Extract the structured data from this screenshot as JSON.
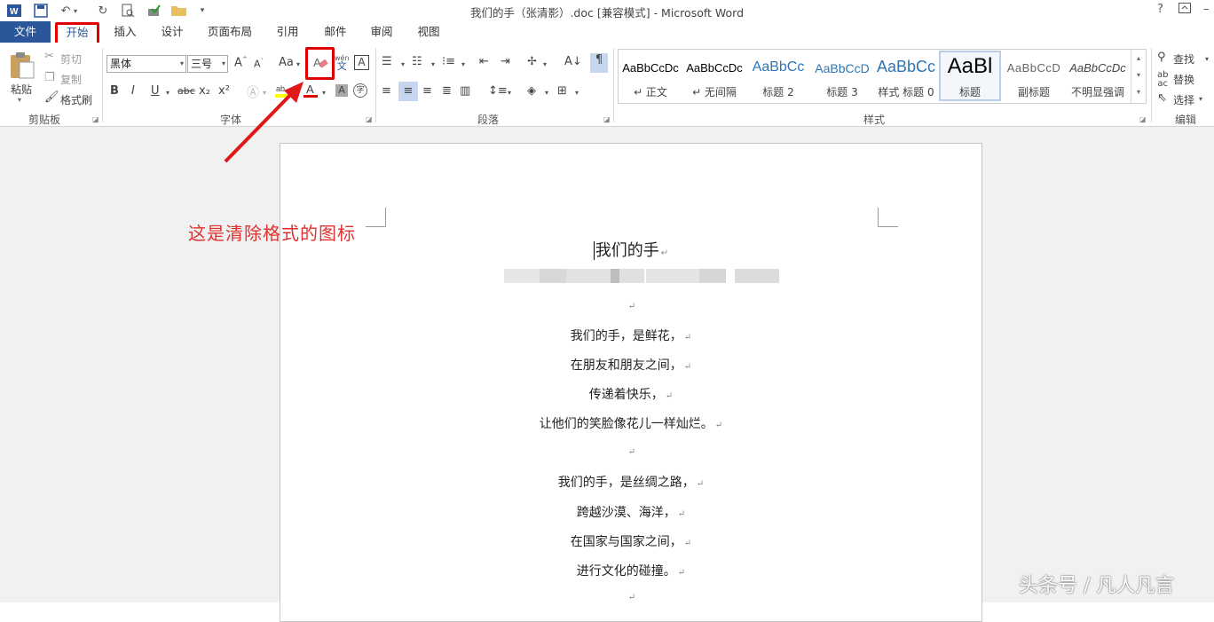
{
  "window": {
    "title": "我们的手（张清影）.doc [兼容模式] - Microsoft Word",
    "help": "?",
    "restore_icon": "ribbon-display-icon",
    "min": "–"
  },
  "tabs": [
    "文件",
    "开始",
    "插入",
    "设计",
    "页面布局",
    "引用",
    "邮件",
    "审阅",
    "视图"
  ],
  "clipboard": {
    "paste": "粘贴",
    "cut": "剪切",
    "copy": "复制",
    "format_painter": "格式刷",
    "group": "剪贴板"
  },
  "font": {
    "name": "黑体",
    "size": "三号",
    "group": "字体",
    "change_case": "Aa",
    "bold": "B",
    "italic": "I",
    "underline": "U",
    "strike": "abc",
    "sub": "x₂",
    "sup": "x²",
    "phonetic_top": "wén",
    "phonetic_bottom": "文",
    "charborder": "A",
    "enclose": "字"
  },
  "paragraph": {
    "group": "段落"
  },
  "styles": {
    "group": "样式",
    "items": [
      {
        "sample": "AaBbCcDc",
        "name": "↵ 正文"
      },
      {
        "sample": "AaBbCcDc",
        "name": "↵ 无间隔"
      },
      {
        "sample": "AaBbCc",
        "name": "标题 2"
      },
      {
        "sample": "AaBbCcD",
        "name": "标题 3"
      },
      {
        "sample": "AaBbCc",
        "name": "样式 标题 0"
      },
      {
        "sample": "AaBl",
        "name": "标题"
      },
      {
        "sample": "AaBbCcD",
        "name": "副标题"
      },
      {
        "sample": "AaBbCcDc",
        "name": "不明显强调"
      }
    ]
  },
  "editing": {
    "find": "查找",
    "replace": "替换",
    "select": "选择",
    "group": "编辑"
  },
  "annotation": "这是清除格式的图标",
  "document": {
    "title": "我们的手",
    "para_mark": "↵",
    "stanza1": [
      "我们的手，是鲜花，",
      "在朋友和朋友之间，",
      "传递着快乐，",
      "让他们的笑脸像花儿一样灿烂。"
    ],
    "stanza2": [
      "我们的手，是丝绸之路，",
      "跨越沙漠、海洋，",
      "在国家与国家之间，",
      "进行文化的碰撞。"
    ]
  },
  "watermark": "头条号 / 凡人凡言",
  "colors": {
    "file_tab": "#2b579a",
    "highlight_box": "#e00000",
    "arrow": "#e01818",
    "annotation": "#e03030"
  }
}
